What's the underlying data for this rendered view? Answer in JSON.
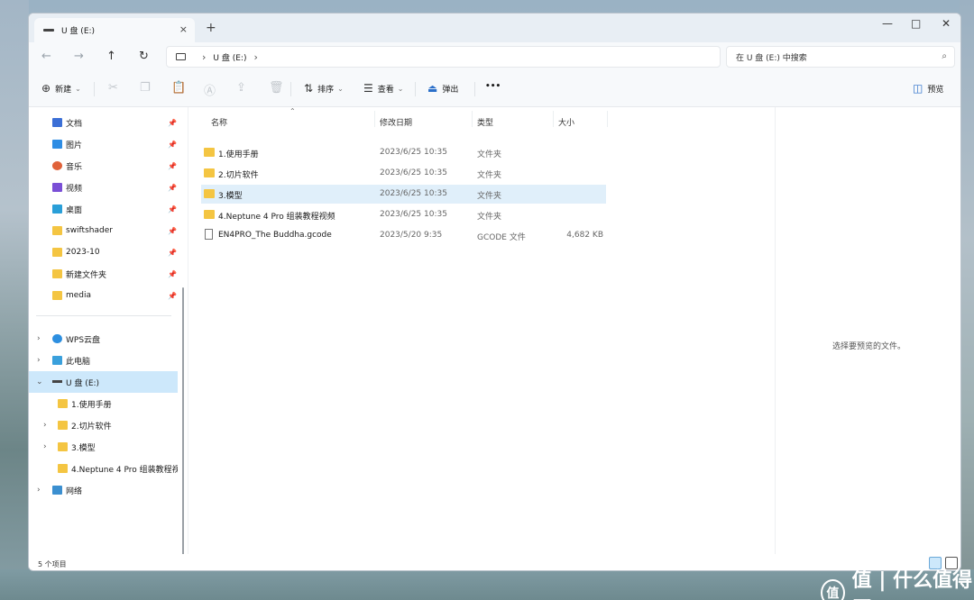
{
  "window": {
    "tab_title": "U 盘 (E:)",
    "new_tab": "+",
    "close_tab": "×",
    "minimize": "—",
    "maximize": "□",
    "close": "✕"
  },
  "nav": {
    "back": "←",
    "forward": "→",
    "up": "↑",
    "refresh": "↻"
  },
  "address": {
    "breadcrumb": [
      "U 盘 (E:)"
    ],
    "separator": "›"
  },
  "search": {
    "placeholder": "在 U 盘 (E:) 中搜索"
  },
  "toolbar": {
    "new_label": "新建",
    "sort_label": "排序",
    "view_label": "查看",
    "eject_label": "弹出",
    "more_label": "•••",
    "preview_label": "预览"
  },
  "sidebar": {
    "quick_access": [
      {
        "label": "文档",
        "icon": "documents-icon",
        "color": "#3b6fd6"
      },
      {
        "label": "图片",
        "icon": "pictures-icon",
        "color": "#2f8de4"
      },
      {
        "label": "音乐",
        "icon": "music-icon",
        "color": "#e0623a"
      },
      {
        "label": "视频",
        "icon": "videos-icon",
        "color": "#7a4fd6"
      },
      {
        "label": "桌面",
        "icon": "desktop-icon",
        "color": "#2a9fd8"
      },
      {
        "label": "swiftshader",
        "icon": "folder-icon",
        "color": "#f4c542"
      },
      {
        "label": "2023-10",
        "icon": "folder-icon",
        "color": "#f4c542"
      },
      {
        "label": "新建文件夹",
        "icon": "folder-icon",
        "color": "#f4c542"
      },
      {
        "label": "media",
        "icon": "folder-icon",
        "color": "#f4c542"
      }
    ],
    "tree": [
      {
        "label": "WPS云盘",
        "icon": "cloud-icon"
      },
      {
        "label": "此电脑",
        "icon": "this-pc-icon"
      },
      {
        "label": "U 盘 (E:)",
        "icon": "usb-drive-icon"
      },
      {
        "label": "1.使用手册",
        "icon": "folder-icon"
      },
      {
        "label": "2.切片软件",
        "icon": "folder-icon"
      },
      {
        "label": "3.模型",
        "icon": "folder-icon"
      },
      {
        "label": "4.Neptune 4 Pro 组装教程视频",
        "icon": "folder-icon"
      },
      {
        "label": "网络",
        "icon": "network-icon"
      }
    ]
  },
  "columns": {
    "name": "名称",
    "date": "修改日期",
    "type": "类型",
    "size": "大小"
  },
  "files": [
    {
      "name": "1.使用手册",
      "date": "2023/6/25 10:35",
      "type": "文件夹",
      "size": "",
      "kind": "folder"
    },
    {
      "name": "2.切片软件",
      "date": "2023/6/25 10:35",
      "type": "文件夹",
      "size": "",
      "kind": "folder"
    },
    {
      "name": "3.模型",
      "date": "2023/6/25 10:35",
      "type": "文件夹",
      "size": "",
      "kind": "folder",
      "selected": true
    },
    {
      "name": "4.Neptune 4 Pro 组装教程视频",
      "date": "2023/6/25 10:35",
      "type": "文件夹",
      "size": "",
      "kind": "folder"
    },
    {
      "name": "EN4PRO_The Buddha.gcode",
      "date": "2023/5/20 9:35",
      "type": "GCODE 文件",
      "size": "4,682 KB",
      "kind": "file"
    }
  ],
  "preview": {
    "message": "选择要预览的文件。"
  },
  "status": {
    "item_count": "5 个项目"
  },
  "watermark": {
    "text": "值 | 什么值得买",
    "logo": "值"
  },
  "colors": {
    "accent": "#0067c0",
    "selection": "#cde8fb",
    "folder": "#f4c542"
  }
}
